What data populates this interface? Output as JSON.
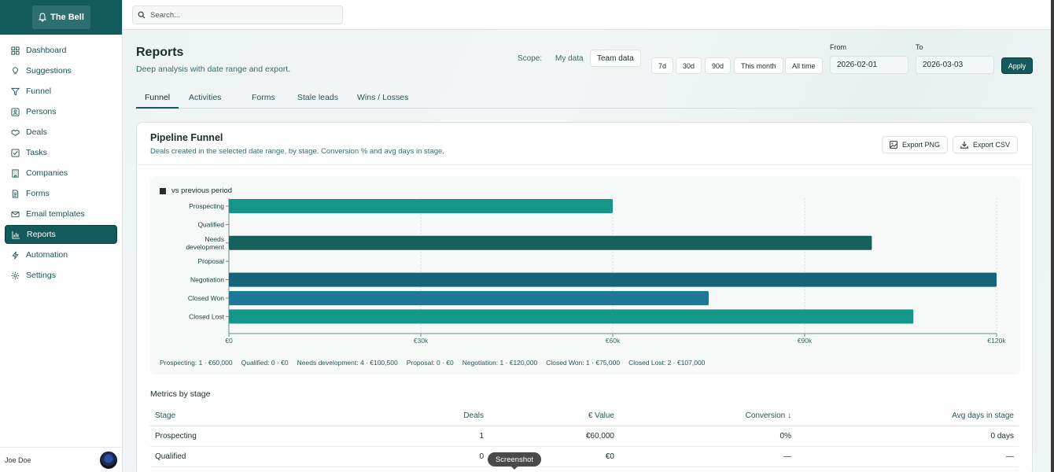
{
  "app": {
    "brand": "The Bell",
    "search_placeholder": "Search..."
  },
  "sidebar": {
    "items": [
      {
        "label": "Dashboard",
        "icon": "grid-icon"
      },
      {
        "label": "Suggestions",
        "icon": "lightbulb-icon"
      },
      {
        "label": "Funnel",
        "icon": "filter-icon"
      },
      {
        "label": "Persons",
        "icon": "person-icon"
      },
      {
        "label": "Deals",
        "icon": "handshake-icon"
      },
      {
        "label": "Tasks",
        "icon": "checkbox-icon"
      },
      {
        "label": "Companies",
        "icon": "building-icon"
      },
      {
        "label": "Forms",
        "icon": "document-icon"
      },
      {
        "label": "Email templates",
        "icon": "mail-icon"
      },
      {
        "label": "Reports",
        "icon": "bar-chart-icon"
      },
      {
        "label": "Automation",
        "icon": "bolt-icon"
      },
      {
        "label": "Settings",
        "icon": "gear-icon"
      }
    ],
    "user_name": "Joe Doe"
  },
  "header": {
    "title": "Reports",
    "subtitle": "Deep analysis with date range and export.",
    "scope_label": "Scope:",
    "scope_my": "My data",
    "scope_team": "Team data",
    "ranges": [
      "7d",
      "30d",
      "90d",
      "This month",
      "All time"
    ],
    "from_label": "From",
    "from_value": "2026-02-01",
    "to_label": "To",
    "to_value": "2026-03-03",
    "apply": "Apply"
  },
  "tabs": [
    "Funnel",
    "Activities",
    "Forms",
    "Stale leads",
    "Wins / Losses"
  ],
  "card": {
    "title": "Pipeline Funnel",
    "subtitle": "Deals created in the selected date range, by stage. Conversion % and avg days in stage.",
    "export_png": "Export PNG",
    "export_csv": "Export CSV",
    "legend": "vs previous period",
    "summary": [
      "Prospecting: 1 · €60,000",
      "Qualified: 0 · €0",
      "Needs development: 4 · €100,500",
      "Proposal: 0 · €0",
      "Negotiation: 1 · €120,000",
      "Closed Won: 1 · €75,000",
      "Closed Lost: 2 · €107,000"
    ]
  },
  "chart_data": {
    "type": "bar",
    "orientation": "horizontal",
    "categories": [
      "Prospecting",
      "Qualified",
      "Needs development",
      "Proposal",
      "Negotiation",
      "Closed Won",
      "Closed Lost"
    ],
    "values": [
      60000,
      0,
      100500,
      0,
      120000,
      75000,
      107000
    ],
    "bar_colors": [
      "#14968a",
      "#14968a",
      "#17615c",
      "#14968a",
      "#17637a",
      "#1c7a98",
      "#14968a"
    ],
    "xlim": [
      0,
      120000
    ],
    "x_ticks": [
      0,
      30000,
      60000,
      90000,
      120000
    ],
    "x_tick_labels": [
      "€0",
      "€30k",
      "€60k",
      "€90k",
      "€120k"
    ],
    "legend": "vs previous period",
    "legend_position": "top-left",
    "grid": true
  },
  "metrics": {
    "title": "Metrics by stage",
    "columns": [
      "Stage",
      "Deals",
      "€ Value",
      "Conversion ↓",
      "Avg days in stage"
    ],
    "rows": [
      [
        "Prospecting",
        "1",
        "€60,000",
        "0%",
        "0 days"
      ],
      [
        "Qualified",
        "0",
        "€0",
        "—",
        "—"
      ]
    ]
  },
  "tooltip": "Screenshot"
}
